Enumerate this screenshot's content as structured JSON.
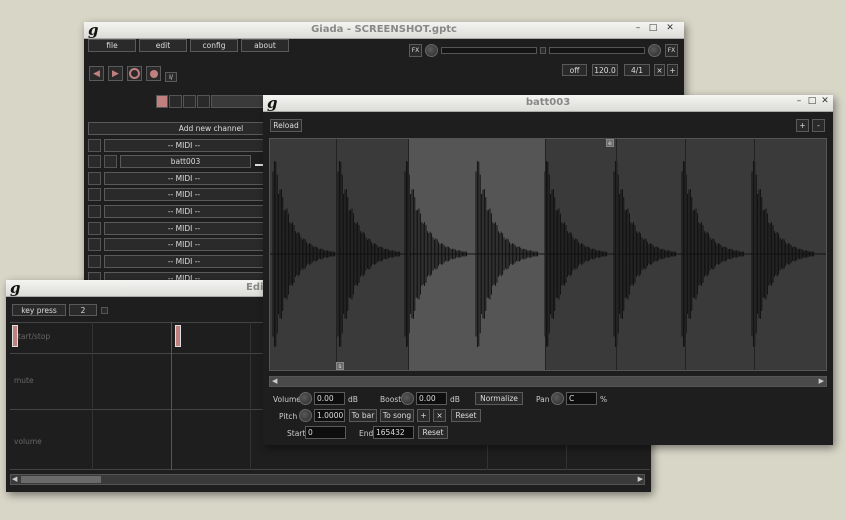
{
  "main_window": {
    "title": "Giada - SCREENSHOT.gptc",
    "menu": [
      "file",
      "edit",
      "config",
      "about"
    ],
    "fx_left": "FX",
    "fx_right": "FX",
    "quantize": "off",
    "bpm": "120.0",
    "meter": "4/1",
    "beat_minus": "×",
    "beat_plus": "+",
    "input_toggle": "I/",
    "add_channel": "Add new channel",
    "channels": [
      "-- MIDI --",
      "batt003",
      "-- MIDI --",
      "-- MIDI --",
      "-- MIDI --",
      "-- MIDI --",
      "-- MIDI --",
      "-- MIDI --",
      "-- MIDI --"
    ]
  },
  "action_editor": {
    "title": "Edi",
    "mode": "key press",
    "grid_value": "2",
    "lanes": [
      "start/stop",
      "mute",
      "volume"
    ]
  },
  "sample_editor": {
    "title": "batt003",
    "reload": "Reload",
    "zoom_in": "+",
    "zoom_out": "-",
    "begin_marker": "s",
    "end_marker": "e",
    "volume_label": "Volume",
    "volume_value": "0.00",
    "volume_unit": "dB",
    "boost_label": "Boost",
    "boost_value": "0.00",
    "boost_unit": "dB",
    "normalize": "Normalize",
    "pan_label": "Pan",
    "pan_value": "C",
    "pan_unit": "%",
    "pitch_label": "Pitch",
    "pitch_value": "1.0000",
    "to_bar": "To bar",
    "to_song": "To song",
    "pitch_up": "+",
    "pitch_down": "×",
    "pitch_reset": "Reset",
    "start_label": "Start",
    "start_value": "0",
    "end_label": "End",
    "end_value": "165432",
    "range_reset": "Reset"
  },
  "colors": {
    "panel": "#1e1e1e",
    "waveform_bg": "#3a3a3a",
    "waveform_selected": "#555555",
    "action_marker": "#c08080"
  }
}
